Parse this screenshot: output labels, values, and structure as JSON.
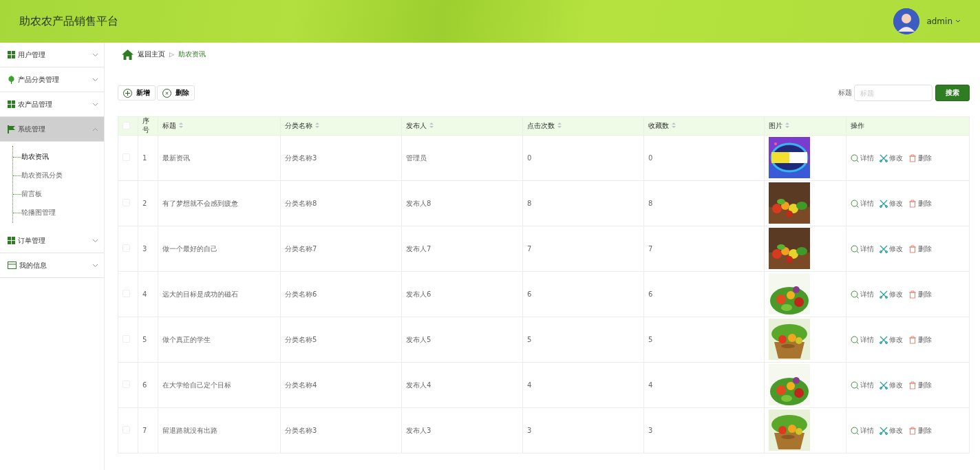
{
  "header": {
    "title": "助农农产品销售平台",
    "user": "admin"
  },
  "sidebar": {
    "items": [
      {
        "label": "用户管理",
        "kind": "grid",
        "expanded": false
      },
      {
        "label": "产品分类管理",
        "kind": "leaf",
        "expanded": false
      },
      {
        "label": "农产品管理",
        "kind": "grid",
        "expanded": false
      },
      {
        "label": "系统管理",
        "kind": "flag",
        "expanded": true,
        "children": [
          {
            "label": "助农资讯",
            "selected": true
          },
          {
            "label": "助农资讯分类",
            "selected": false
          },
          {
            "label": "留言板",
            "selected": false
          },
          {
            "label": "轮播图管理",
            "selected": false
          }
        ]
      },
      {
        "label": "订单管理",
        "kind": "grid",
        "expanded": false
      },
      {
        "label": "我的信息",
        "kind": "card",
        "expanded": false
      }
    ]
  },
  "breadcrumb": {
    "home": "返回主页",
    "separator": "▷",
    "current": "助农资讯"
  },
  "toolbar": {
    "add": "新增",
    "delete": "删除",
    "search_label": "标题",
    "search_placeholder": "标题",
    "search_button": "搜索"
  },
  "table": {
    "select_all_checked": false,
    "columns": [
      {
        "label": "序号",
        "sortable": false
      },
      {
        "label": "标题",
        "sortable": true
      },
      {
        "label": "分类名称",
        "sortable": true
      },
      {
        "label": "发布人",
        "sortable": true
      },
      {
        "label": "点击次数",
        "sortable": true
      },
      {
        "label": "收藏数",
        "sortable": true
      },
      {
        "label": "图片",
        "sortable": true
      },
      {
        "label": "操作",
        "sortable": false
      }
    ],
    "rows": [
      {
        "index": "1",
        "title": "最新资讯",
        "category": "分类名称3",
        "publisher": "管理员",
        "clicks": "0",
        "favorites": "0",
        "checked": false,
        "actions": [
          "详情",
          "修改",
          "删除"
        ]
      },
      {
        "index": "2",
        "title": "有了梦想就不会感到疲惫",
        "category": "分类名称8",
        "publisher": "发布人8",
        "clicks": "8",
        "favorites": "8",
        "checked": false,
        "actions": [
          "详情",
          "修改",
          "删除"
        ]
      },
      {
        "index": "3",
        "title": "做一个最好的自己",
        "category": "分类名称7",
        "publisher": "发布人7",
        "clicks": "7",
        "favorites": "7",
        "checked": false,
        "actions": [
          "详情",
          "修改",
          "删除"
        ]
      },
      {
        "index": "4",
        "title": "远大的目标是成功的磁石",
        "category": "分类名称6",
        "publisher": "发布人6",
        "clicks": "6",
        "favorites": "6",
        "checked": false,
        "actions": [
          "详情",
          "修改",
          "删除"
        ]
      },
      {
        "index": "5",
        "title": "做个真正的学生",
        "category": "分类名称5",
        "publisher": "发布人5",
        "clicks": "5",
        "favorites": "5",
        "checked": false,
        "actions": [
          "详情",
          "修改",
          "删除"
        ]
      },
      {
        "index": "6",
        "title": "在大学给自己定个目标",
        "category": "分类名称4",
        "publisher": "发布人4",
        "clicks": "4",
        "favorites": "4",
        "checked": false,
        "actions": [
          "详情",
          "修改",
          "删除"
        ]
      },
      {
        "index": "7",
        "title": "留退路就没有出路",
        "category": "分类名称3",
        "publisher": "发布人3",
        "clicks": "3",
        "favorites": "3",
        "checked": false,
        "actions": [
          "详情",
          "修改",
          "删除"
        ]
      }
    ]
  }
}
